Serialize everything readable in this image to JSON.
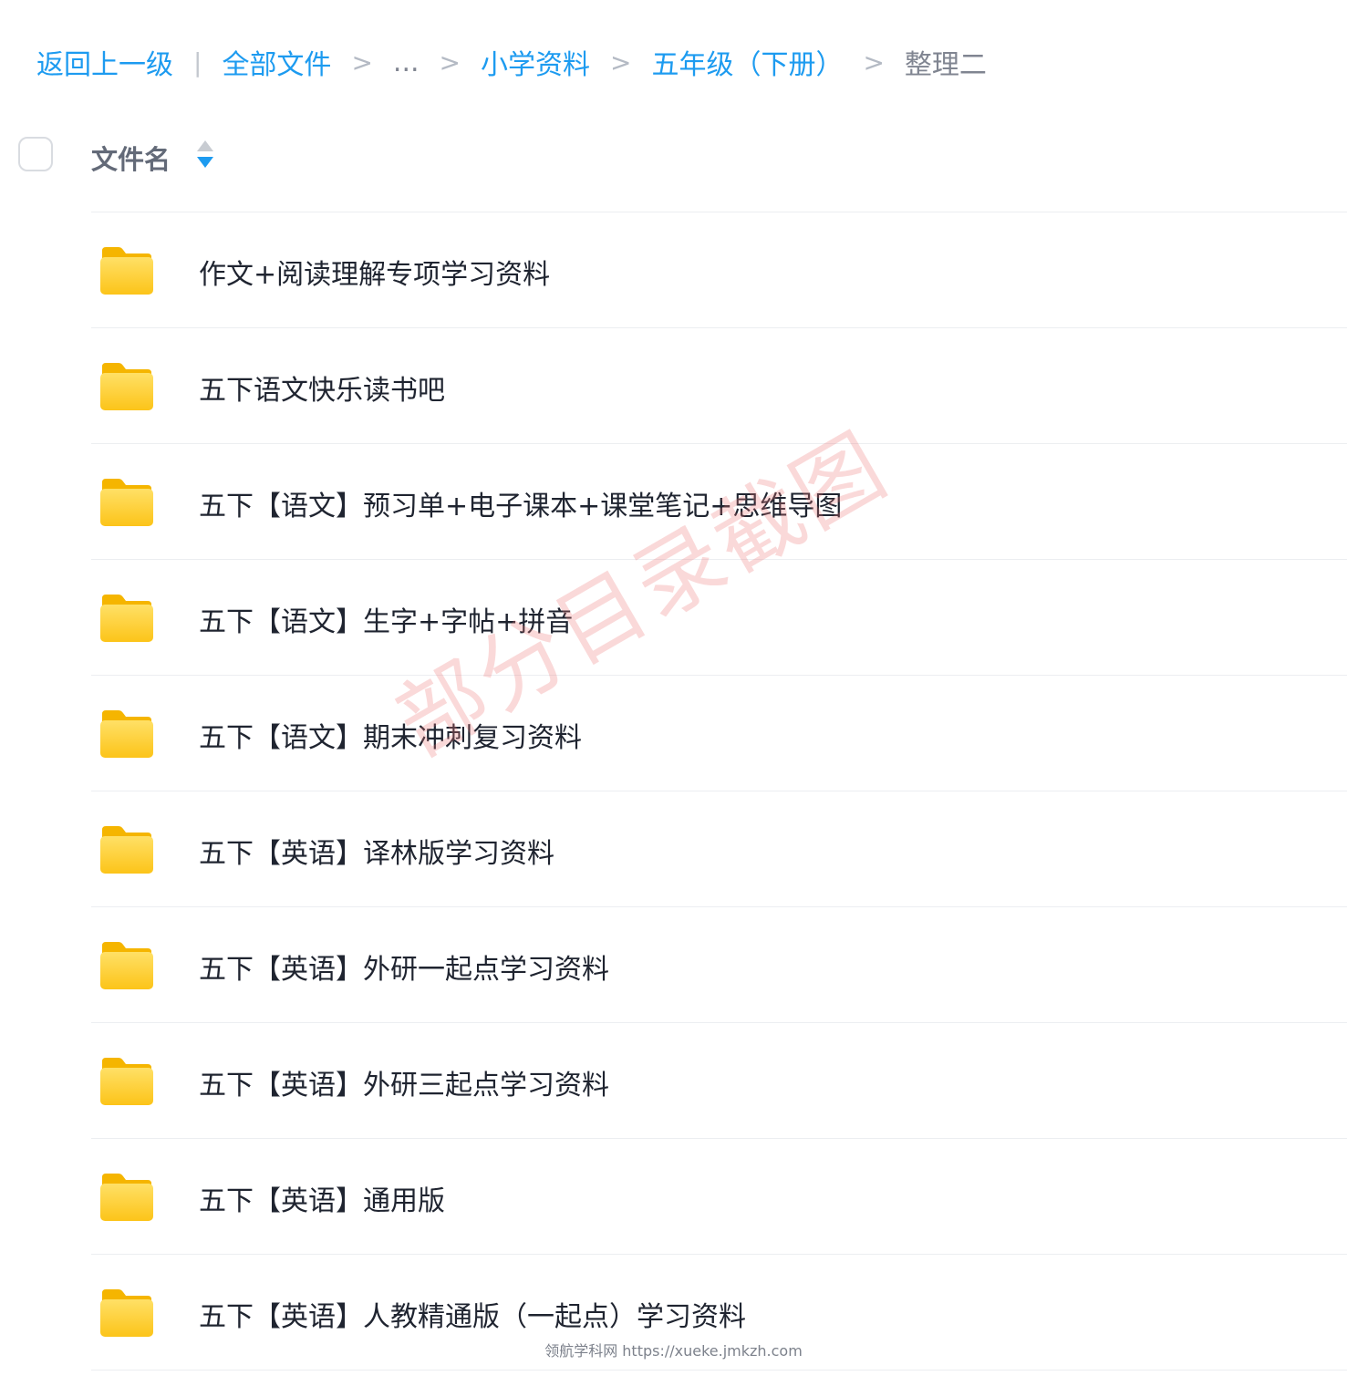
{
  "breadcrumb": {
    "back_label": "返回上一级",
    "divider": "|",
    "separator": ">",
    "items": [
      "全部文件",
      "...",
      "小学资料",
      "五年级（下册）",
      "整理二"
    ]
  },
  "header": {
    "column_name": "文件名",
    "select_all_checked": false,
    "sort_icon": "sort-updown-icon"
  },
  "files": [
    {
      "name": "作文+阅读理解专项学习资料",
      "type": "folder"
    },
    {
      "name": "五下语文快乐读书吧",
      "type": "folder"
    },
    {
      "name": "五下【语文】预习单+电子课本+课堂笔记+思维导图",
      "type": "folder"
    },
    {
      "name": "五下【语文】生字+字帖+拼音",
      "type": "folder"
    },
    {
      "name": "五下【语文】期末冲刺复习资料",
      "type": "folder"
    },
    {
      "name": "五下【英语】译林版学习资料",
      "type": "folder"
    },
    {
      "name": "五下【英语】外研一起点学习资料",
      "type": "folder"
    },
    {
      "name": "五下【英语】外研三起点学习资料",
      "type": "folder"
    },
    {
      "name": "五下【英语】通用版",
      "type": "folder"
    },
    {
      "name": "五下【英语】人教精通版（一起点）学习资料",
      "type": "folder"
    }
  ],
  "watermark": "部分目录截图",
  "footer_credit": "领航学科网 https://xueke.jmkzh.com",
  "colors": {
    "link": "#1d9bf0",
    "folder": "#ffd43b",
    "watermark": "#ec7878"
  }
}
